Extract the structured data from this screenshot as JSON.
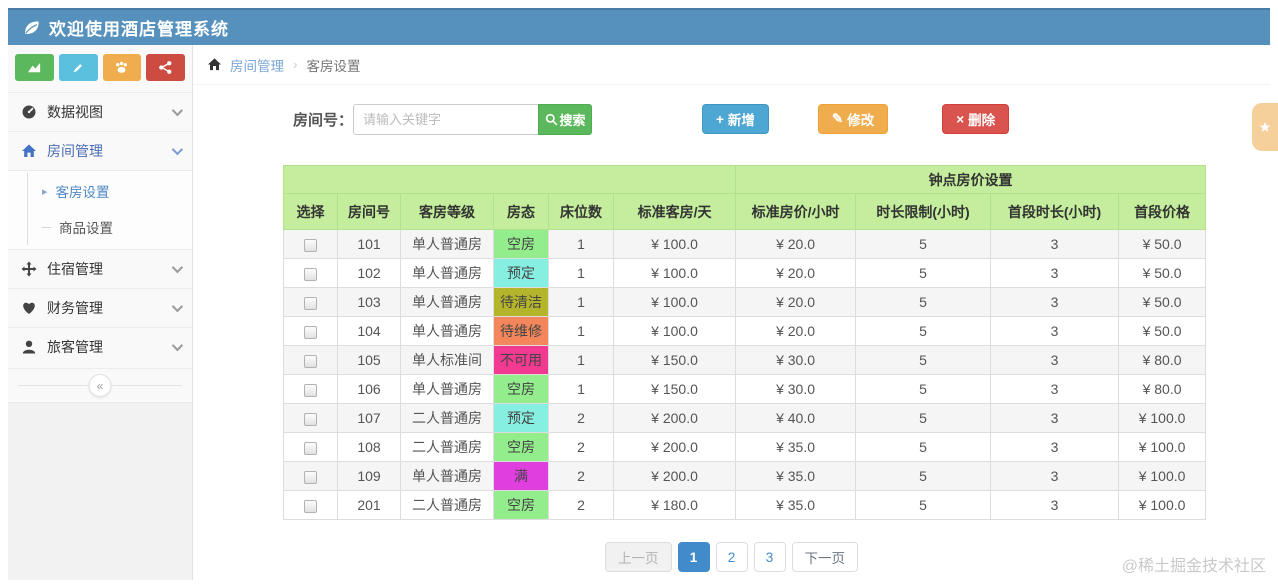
{
  "app": {
    "title": "欢迎使用酒店管理系统"
  },
  "breadcrumb": {
    "section": "房间管理",
    "separator": "›",
    "current": "客房设置"
  },
  "sidebar": {
    "quick_buttons": [
      {
        "icon": "area-chart-icon",
        "color": "#5cb85c"
      },
      {
        "icon": "pencil-icon",
        "color": "#5bc0de"
      },
      {
        "icon": "paw-icon",
        "color": "#f0ad4e"
      },
      {
        "icon": "share-icon",
        "color": "#cd4c41"
      }
    ],
    "items": [
      {
        "label": "数据视图",
        "icon": "gauge-icon"
      },
      {
        "label": "房间管理",
        "icon": "home-icon",
        "active": true
      },
      {
        "label": "住宿管理",
        "icon": "move-icon"
      },
      {
        "label": "财务管理",
        "icon": "heart-icon"
      },
      {
        "label": "旅客管理",
        "icon": "user-icon"
      }
    ],
    "submenu": [
      {
        "label": "客房设置",
        "active": true
      },
      {
        "label": "商品设置",
        "active": false
      }
    ],
    "collapse_glyph": "«"
  },
  "toolbar": {
    "search_label": "房间号：",
    "search_placeholder": "请输入关键字",
    "search_button": "搜索",
    "add_button": "新增",
    "edit_button": "修改",
    "delete_button": "删除",
    "add_icon": "+",
    "edit_icon": "✎",
    "delete_icon": "×"
  },
  "table": {
    "group_header": "钟点房价设置",
    "headers": [
      "选择",
      "房间号",
      "客房等级",
      "房态",
      "床位数",
      "标准客房/天",
      "标准房价/小时",
      "时长限制(小时)",
      "首段时长(小时)",
      "首段价格"
    ],
    "status_colors": {
      "空房": "#94ed8d",
      "预定": "#87efe2",
      "待清洁": "#b5b52c",
      "待维修": "#f3875b",
      "不可用": "#f23a92",
      "满": "#df3fdf"
    },
    "rows": [
      {
        "room": "101",
        "grade": "单人普通房",
        "status": "空房",
        "beds": "1",
        "day_price": "¥ 100.0",
        "hour_price": "¥ 20.0",
        "limit": "5",
        "first_len": "3",
        "first_price": "¥ 50.0"
      },
      {
        "room": "102",
        "grade": "单人普通房",
        "status": "预定",
        "beds": "1",
        "day_price": "¥ 100.0",
        "hour_price": "¥ 20.0",
        "limit": "5",
        "first_len": "3",
        "first_price": "¥ 50.0"
      },
      {
        "room": "103",
        "grade": "单人普通房",
        "status": "待清洁",
        "beds": "1",
        "day_price": "¥ 100.0",
        "hour_price": "¥ 20.0",
        "limit": "5",
        "first_len": "3",
        "first_price": "¥ 50.0"
      },
      {
        "room": "104",
        "grade": "单人普通房",
        "status": "待维修",
        "beds": "1",
        "day_price": "¥ 100.0",
        "hour_price": "¥ 20.0",
        "limit": "5",
        "first_len": "3",
        "first_price": "¥ 50.0"
      },
      {
        "room": "105",
        "grade": "单人标准间",
        "status": "不可用",
        "beds": "1",
        "day_price": "¥ 150.0",
        "hour_price": "¥ 30.0",
        "limit": "5",
        "first_len": "3",
        "first_price": "¥ 80.0"
      },
      {
        "room": "106",
        "grade": "单人普通房",
        "status": "空房",
        "beds": "1",
        "day_price": "¥ 150.0",
        "hour_price": "¥ 30.0",
        "limit": "5",
        "first_len": "3",
        "first_price": "¥ 80.0"
      },
      {
        "room": "107",
        "grade": "二人普通房",
        "status": "预定",
        "beds": "2",
        "day_price": "¥ 200.0",
        "hour_price": "¥ 40.0",
        "limit": "5",
        "first_len": "3",
        "first_price": "¥ 100.0"
      },
      {
        "room": "108",
        "grade": "二人普通房",
        "status": "空房",
        "beds": "2",
        "day_price": "¥ 200.0",
        "hour_price": "¥ 35.0",
        "limit": "5",
        "first_len": "3",
        "first_price": "¥ 100.0"
      },
      {
        "room": "109",
        "grade": "单人普通房",
        "status": "满",
        "beds": "2",
        "day_price": "¥ 200.0",
        "hour_price": "¥ 35.0",
        "limit": "5",
        "first_len": "3",
        "first_price": "¥ 100.0"
      },
      {
        "room": "201",
        "grade": "二人普通房",
        "status": "空房",
        "beds": "2",
        "day_price": "¥ 180.0",
        "hour_price": "¥ 35.0",
        "limit": "5",
        "first_len": "3",
        "first_price": "¥ 100.0"
      }
    ]
  },
  "pagination": {
    "prev": "上一页",
    "pages": [
      "1",
      "2",
      "3"
    ],
    "active_page": "1",
    "next": "下一页"
  },
  "watermark": "@稀土掘金技术社区",
  "colors": {
    "topbar": "#5591bc",
    "table_header": "#c4ee9d",
    "accent_blue": "#428bca"
  }
}
